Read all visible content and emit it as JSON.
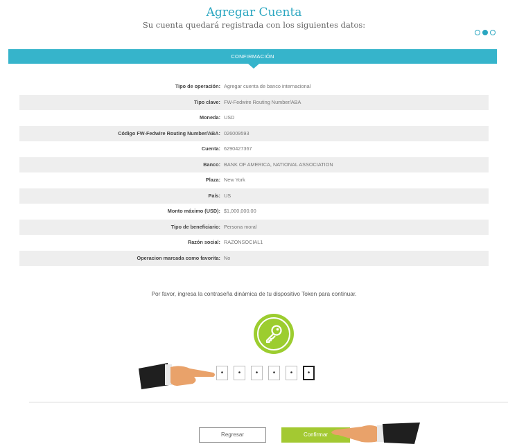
{
  "header": {
    "title": "Agregar Cuenta",
    "subtitle": "Su cuenta quedará registrada con los siguientes datos:",
    "steps_total": 3,
    "step_current": 2
  },
  "section": {
    "title": "CONFIRMACIÓN"
  },
  "details": [
    {
      "label": "Tipo de operación:",
      "value": "Agregar cuenta de banco internacional"
    },
    {
      "label": "Tipo clave:",
      "value": "FW-Fedwire Routing Number/ABA"
    },
    {
      "label": "Moneda:",
      "value": "USD"
    },
    {
      "label": "Código FW-Fedwire Routing Number/ABA:",
      "value": "026009593"
    },
    {
      "label": "Cuenta:",
      "value": "6290427367"
    },
    {
      "label": "Banco:",
      "value": "BANK OF AMERICA, NATIONAL ASSOCIATION"
    },
    {
      "label": "Plaza:",
      "value": "New York"
    },
    {
      "label": "País:",
      "value": "US"
    },
    {
      "label": "Monto máximo (USD):",
      "value": "$1,000,000.00"
    },
    {
      "label": "Tipo de beneficiario:",
      "value": "Persona moral"
    },
    {
      "label": "Razón social:",
      "value": "RAZONSOCIAL1"
    },
    {
      "label": "Operacion marcada como favorita:",
      "value": "No"
    }
  ],
  "token": {
    "prompt": "Por favor, ingresa la contraseña dinámica de tu dispositivo Token para continuar.",
    "digits": [
      "•",
      "•",
      "•",
      "•",
      "•",
      "•"
    ],
    "icon": "key-icon"
  },
  "actions": {
    "back_label": "Regresar",
    "confirm_label": "Confirmar"
  },
  "colors": {
    "accent": "#36b4cb",
    "confirm": "#a3c932",
    "token_icon": "#9ccd2f"
  }
}
